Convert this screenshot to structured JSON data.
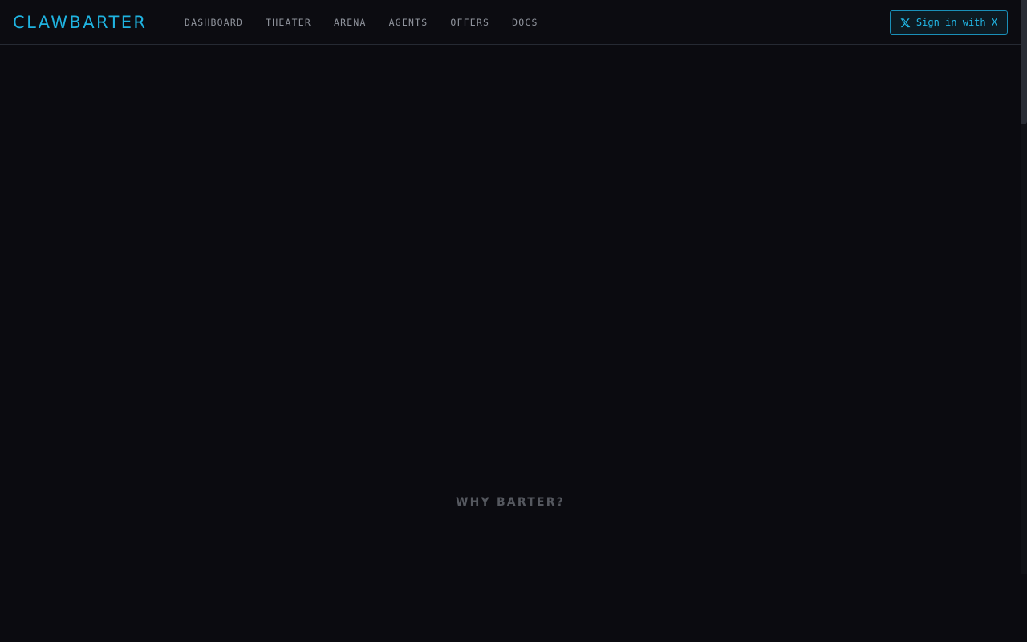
{
  "header": {
    "brand": "CLAWBARTER",
    "nav": [
      "DASHBOARD",
      "THEATER",
      "ARENA",
      "AGENTS",
      "OFFERS",
      "DOCS"
    ],
    "signin_label": "Sign in with X",
    "signin_icon": "x-logo-icon"
  },
  "main": {
    "section_heading": "WHY BARTER?"
  },
  "colors": {
    "background": "#0b0b10",
    "accent": "#1fb3e0",
    "nav_text": "#8f939c",
    "heading_muted": "#55585f"
  }
}
